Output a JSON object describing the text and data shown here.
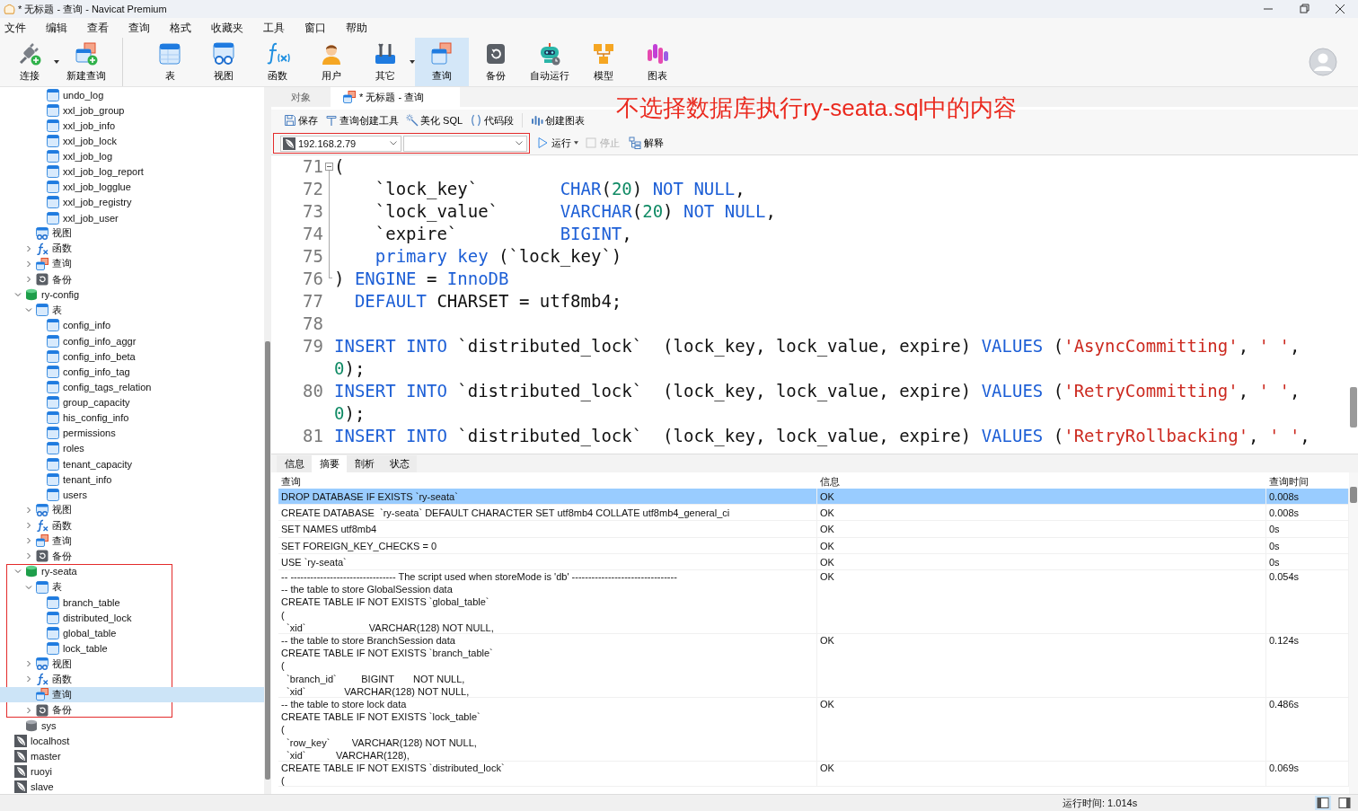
{
  "window": {
    "title": "* 无标题 - 查询 - Navicat Premium"
  },
  "menu": [
    "文件",
    "编辑",
    "查看",
    "查询",
    "格式",
    "收藏夹",
    "工具",
    "窗口",
    "帮助"
  ],
  "toolbar": [
    {
      "label": "连接",
      "kind": "connect",
      "selected": false,
      "has_menu": true,
      "separator_after": false
    },
    {
      "label": "新建查询",
      "kind": "new-query",
      "selected": false,
      "has_menu": false,
      "separator_after": true
    },
    {
      "label": "表",
      "kind": "table",
      "selected": false,
      "has_menu": false,
      "separator_after": false
    },
    {
      "label": "视图",
      "kind": "view",
      "selected": false,
      "has_menu": false,
      "separator_after": false
    },
    {
      "label": "函数",
      "kind": "function",
      "selected": false,
      "has_menu": false,
      "separator_after": false
    },
    {
      "label": "用户",
      "kind": "user",
      "selected": false,
      "has_menu": false,
      "separator_after": false
    },
    {
      "label": "其它",
      "kind": "other",
      "selected": false,
      "has_menu": true,
      "separator_after": false
    },
    {
      "label": "查询",
      "kind": "query",
      "selected": true,
      "has_menu": false,
      "separator_after": false
    },
    {
      "label": "备份",
      "kind": "backup",
      "selected": false,
      "has_menu": false,
      "separator_after": false
    },
    {
      "label": "自动运行",
      "kind": "automation",
      "selected": false,
      "has_menu": false,
      "separator_after": false
    },
    {
      "label": "模型",
      "kind": "model",
      "selected": false,
      "has_menu": false,
      "separator_after": false
    },
    {
      "label": "图表",
      "kind": "chart",
      "selected": false,
      "has_menu": false,
      "separator_after": false
    }
  ],
  "sidebar": {
    "tree": [
      {
        "children": [
          {
            "children": [
              {
                "children": [
                  {
                    "kind": "table",
                    "label": "undo_log",
                    "selected": false
                  },
                  {
                    "kind": "table",
                    "label": "xxl_job_group",
                    "selected": false
                  },
                  {
                    "kind": "table",
                    "label": "xxl_job_info",
                    "selected": false
                  },
                  {
                    "kind": "table",
                    "label": "xxl_job_lock",
                    "selected": false
                  },
                  {
                    "kind": "table",
                    "label": "xxl_job_log",
                    "selected": false
                  },
                  {
                    "kind": "table",
                    "label": "xxl_job_log_report",
                    "selected": false
                  },
                  {
                    "kind": "table",
                    "label": "xxl_job_logglue",
                    "selected": false
                  },
                  {
                    "kind": "table",
                    "label": "xxl_job_registry",
                    "selected": false
                  },
                  {
                    "kind": "table",
                    "label": "xxl_job_user",
                    "selected": false
                  }
                ]
              },
              {
                "kind": "views",
                "label": "视图",
                "selected": false
              },
              {
                "kind": "functions",
                "label": "函数",
                "selected": false,
                "expanded": false
              },
              {
                "kind": "queries",
                "label": "查询",
                "selected": false,
                "expanded": false
              },
              {
                "kind": "backups",
                "label": "备份",
                "selected": false,
                "expanded": false
              }
            ]
          },
          {
            "kind": "database",
            "label": "ry-config",
            "selected": false,
            "expanded": true,
            "children": [
              {
                "kind": "tables",
                "label": "表",
                "selected": false,
                "expanded": true,
                "children": [
                  {
                    "kind": "table",
                    "label": "config_info",
                    "selected": false
                  },
                  {
                    "kind": "table",
                    "label": "config_info_aggr",
                    "selected": false
                  },
                  {
                    "kind": "table",
                    "label": "config_info_beta",
                    "selected": false
                  },
                  {
                    "kind": "table",
                    "label": "config_info_tag",
                    "selected": false
                  },
                  {
                    "kind": "table",
                    "label": "config_tags_relation",
                    "selected": false
                  },
                  {
                    "kind": "table",
                    "label": "group_capacity",
                    "selected": false
                  },
                  {
                    "kind": "table",
                    "label": "his_config_info",
                    "selected": false
                  },
                  {
                    "kind": "table",
                    "label": "permissions",
                    "selected": false
                  },
                  {
                    "kind": "table",
                    "label": "roles",
                    "selected": false
                  },
                  {
                    "kind": "table",
                    "label": "tenant_capacity",
                    "selected": false
                  },
                  {
                    "kind": "table",
                    "label": "tenant_info",
                    "selected": false
                  },
                  {
                    "kind": "table",
                    "label": "users",
                    "selected": false
                  }
                ]
              },
              {
                "kind": "views",
                "label": "视图",
                "selected": false,
                "expanded": false
              },
              {
                "kind": "functions",
                "label": "函数",
                "selected": false,
                "expanded": false
              },
              {
                "kind": "queries",
                "label": "查询",
                "selected": false,
                "expanded": false
              },
              {
                "kind": "backups",
                "label": "备份",
                "selected": false,
                "expanded": false
              }
            ]
          },
          {
            "kind": "database",
            "label": "ry-seata",
            "selected": false,
            "expanded": true,
            "outlined": true,
            "children": [
              {
                "kind": "tables",
                "label": "表",
                "selected": false,
                "expanded": true,
                "children": [
                  {
                    "kind": "table",
                    "label": "branch_table",
                    "selected": false
                  },
                  {
                    "kind": "table",
                    "label": "distributed_lock",
                    "selected": false
                  },
                  {
                    "kind": "table",
                    "label": "global_table",
                    "selected": false
                  },
                  {
                    "kind": "table",
                    "label": "lock_table",
                    "selected": false
                  }
                ]
              },
              {
                "kind": "views",
                "label": "视图",
                "selected": false,
                "expanded": false
              },
              {
                "kind": "functions",
                "label": "函数",
                "selected": false,
                "expanded": false
              },
              {
                "kind": "queries",
                "label": "查询",
                "selected": true
              },
              {
                "kind": "backups",
                "label": "备份",
                "selected": false,
                "expanded": false
              }
            ]
          },
          {
            "kind": "database-closed",
            "label": "sys",
            "selected": false
          }
        ]
      },
      {
        "kind": "connection",
        "label": "localhost",
        "selected": false
      },
      {
        "kind": "connection",
        "label": "master",
        "selected": false
      },
      {
        "kind": "connection",
        "label": "ruoyi",
        "selected": false
      },
      {
        "kind": "connection",
        "label": "slave",
        "selected": false
      }
    ]
  },
  "editor_tabs": [
    {
      "label": "对象",
      "kind": "objects",
      "selected": false
    },
    {
      "label": "* 无标题 - 查询",
      "kind": "query",
      "selected": true
    }
  ],
  "query_toolbar": [
    {
      "label": "保存",
      "kind": "save"
    },
    {
      "label": "查询创建工具",
      "kind": "builder"
    },
    {
      "label": "美化 SQL",
      "kind": "beautify"
    },
    {
      "label": "代码段",
      "kind": "snippet"
    },
    {
      "label": "创建图表",
      "kind": "chart"
    }
  ],
  "run_bar": {
    "connection": "192.168.2.79",
    "outlined": true,
    "actions": [
      {
        "label": "运行",
        "kind": "run",
        "disabled": false,
        "has_menu": true
      },
      {
        "label": "停止",
        "kind": "stop",
        "disabled": true,
        "has_menu": false
      },
      {
        "label": "解释",
        "kind": "explain",
        "disabled": false,
        "has_menu": false
      }
    ]
  },
  "annotation": {
    "text": "不选择数据库执行ry-seata.sql中的内容"
  },
  "editor": {
    "lines": [
      {
        "number": "71",
        "fold_start": true,
        "wrapped": [
          {
            "tokens": [
              {
                "text": "(",
                "kind": "plain"
              }
            ]
          }
        ]
      },
      {
        "number": "72",
        "wrapped": [
          {
            "tokens": [
              {
                "text": "    `lock_key`        ",
                "kind": "plain"
              },
              {
                "text": "CHAR",
                "kind": "keyword"
              },
              {
                "text": "(",
                "kind": "plain"
              },
              {
                "text": "20",
                "kind": "number"
              },
              {
                "text": ") ",
                "kind": "plain"
              },
              {
                "text": "NOT NULL",
                "kind": "keyword"
              },
              {
                "text": ",",
                "kind": "plain"
              }
            ]
          }
        ]
      },
      {
        "number": "73",
        "wrapped": [
          {
            "tokens": [
              {
                "text": "    `lock_value`      ",
                "kind": "plain"
              },
              {
                "text": "VARCHAR",
                "kind": "keyword"
              },
              {
                "text": "(",
                "kind": "plain"
              },
              {
                "text": "20",
                "kind": "number"
              },
              {
                "text": ") ",
                "kind": "plain"
              },
              {
                "text": "NOT NULL",
                "kind": "keyword"
              },
              {
                "text": ",",
                "kind": "plain"
              }
            ]
          }
        ]
      },
      {
        "number": "74",
        "wrapped": [
          {
            "tokens": [
              {
                "text": "    `expire`          ",
                "kind": "plain"
              },
              {
                "text": "BIGINT",
                "kind": "keyword"
              },
              {
                "text": ",",
                "kind": "plain"
              }
            ]
          }
        ]
      },
      {
        "number": "75",
        "wrapped": [
          {
            "tokens": [
              {
                "text": "    primary key",
                "kind": "keyword"
              },
              {
                "text": " (`lock_key`)",
                "kind": "plain"
              }
            ]
          }
        ]
      },
      {
        "number": "76",
        "fold_end": true,
        "wrapped": [
          {
            "tokens": [
              {
                "text": ") ",
                "kind": "plain"
              },
              {
                "text": "ENGINE",
                "kind": "keyword"
              },
              {
                "text": " = ",
                "kind": "plain"
              },
              {
                "text": "InnoDB",
                "kind": "keyword"
              }
            ]
          }
        ]
      },
      {
        "number": "77",
        "wrapped": [
          {
            "tokens": [
              {
                "text": "  DEFAULT",
                "kind": "keyword"
              },
              {
                "text": " CHARSET = utf8mb4;",
                "kind": "plain"
              }
            ]
          }
        ]
      },
      {
        "number": "78"
      },
      {
        "number": "79",
        "wrapped": [
          {
            "tokens": [
              {
                "text": "INSERT INTO",
                "kind": "keyword"
              },
              {
                "text": " `distributed_lock`  (lock_key, lock_value, expire) ",
                "kind": "plain"
              },
              {
                "text": "VALUES",
                "kind": "keyword"
              },
              {
                "text": " (",
                "kind": "plain"
              },
              {
                "text": "'AsyncCommitting'",
                "kind": "string"
              },
              {
                "text": ", ",
                "kind": "plain"
              },
              {
                "text": "' '",
                "kind": "string"
              },
              {
                "text": ",",
                "kind": "plain"
              }
            ]
          },
          {
            "tokens": [
              {
                "text": "0",
                "kind": "number"
              },
              {
                "text": ");",
                "kind": "plain"
              }
            ]
          }
        ]
      },
      {
        "number": "80",
        "wrapped": [
          {
            "tokens": [
              {
                "text": "INSERT INTO",
                "kind": "keyword"
              },
              {
                "text": " `distributed_lock`  (lock_key, lock_value, expire) ",
                "kind": "plain"
              },
              {
                "text": "VALUES",
                "kind": "keyword"
              },
              {
                "text": " (",
                "kind": "plain"
              },
              {
                "text": "'RetryCommitting'",
                "kind": "string"
              },
              {
                "text": ", ",
                "kind": "plain"
              },
              {
                "text": "' '",
                "kind": "string"
              },
              {
                "text": ",",
                "kind": "plain"
              }
            ]
          },
          {
            "tokens": [
              {
                "text": "0",
                "kind": "number"
              },
              {
                "text": ");",
                "kind": "plain"
              }
            ]
          }
        ]
      },
      {
        "number": "81",
        "wrapped": [
          {
            "tokens": [
              {
                "text": "INSERT INTO",
                "kind": "keyword"
              },
              {
                "text": " `distributed_lock`  (lock_key, lock_value, expire) ",
                "kind": "plain"
              },
              {
                "text": "VALUES",
                "kind": "keyword"
              },
              {
                "text": " (",
                "kind": "plain"
              },
              {
                "text": "'RetryRollbacking'",
                "kind": "string"
              },
              {
                "text": ", ",
                "kind": "plain"
              },
              {
                "text": "' '",
                "kind": "string"
              },
              {
                "text": ",",
                "kind": "plain"
              }
            ]
          }
        ]
      }
    ]
  },
  "results": {
    "tabs": [
      {
        "label": "信息",
        "selected": false
      },
      {
        "label": "摘要",
        "selected": true
      },
      {
        "label": "剖析",
        "selected": false
      },
      {
        "label": "状态",
        "selected": false
      }
    ],
    "columns": [
      "查询",
      "信息",
      "查询时间"
    ],
    "rows": [
      {
        "query": [
          "DROP DATABASE IF EXISTS `ry-seata`"
        ],
        "message": "OK",
        "time": "0.008s",
        "selected": true
      },
      {
        "query": [
          "CREATE DATABASE  `ry-seata` DEFAULT CHARACTER SET utf8mb4 COLLATE utf8mb4_general_ci"
        ],
        "message": "OK",
        "time": "0.008s",
        "selected": false
      },
      {
        "query": [
          "SET NAMES utf8mb4"
        ],
        "message": "OK",
        "time": "0s",
        "selected": false
      },
      {
        "query": [
          "SET FOREIGN_KEY_CHECKS = 0"
        ],
        "message": "OK",
        "time": "0s",
        "selected": false
      },
      {
        "query": [
          "USE `ry-seata`"
        ],
        "message": "OK",
        "time": "0s",
        "selected": false
      },
      {
        "query": [
          "-- -------------------------------- The script used when storeMode is 'db' --------------------------------",
          "-- the table to store GlobalSession data",
          "CREATE TABLE IF NOT EXISTS `global_table`",
          "(",
          "  `xid`                       VARCHAR(128) NOT NULL,"
        ],
        "message": "OK",
        "time": "0.054s",
        "selected": false
      },
      {
        "query": [
          "-- the table to store BranchSession data",
          "CREATE TABLE IF NOT EXISTS `branch_table`",
          "(",
          "  `branch_id`         BIGINT       NOT NULL,",
          "  `xid`              VARCHAR(128) NOT NULL,"
        ],
        "message": "OK",
        "time": "0.124s",
        "selected": false
      },
      {
        "query": [
          "-- the table to store lock data",
          "CREATE TABLE IF NOT EXISTS `lock_table`",
          "(",
          "  `row_key`        VARCHAR(128) NOT NULL,",
          "  `xid`           VARCHAR(128),"
        ],
        "message": "OK",
        "time": "0.486s",
        "selected": false
      },
      {
        "query": [
          "CREATE TABLE IF NOT EXISTS `distributed_lock`",
          "("
        ],
        "message": "OK",
        "time": "0.069s",
        "selected": false
      }
    ]
  },
  "status_bar": {
    "text": "运行时间: 1.014s",
    "view_buttons": [
      {
        "kind": "left-pane",
        "selected": true
      },
      {
        "kind": "right-pane",
        "selected": false
      }
    ]
  }
}
